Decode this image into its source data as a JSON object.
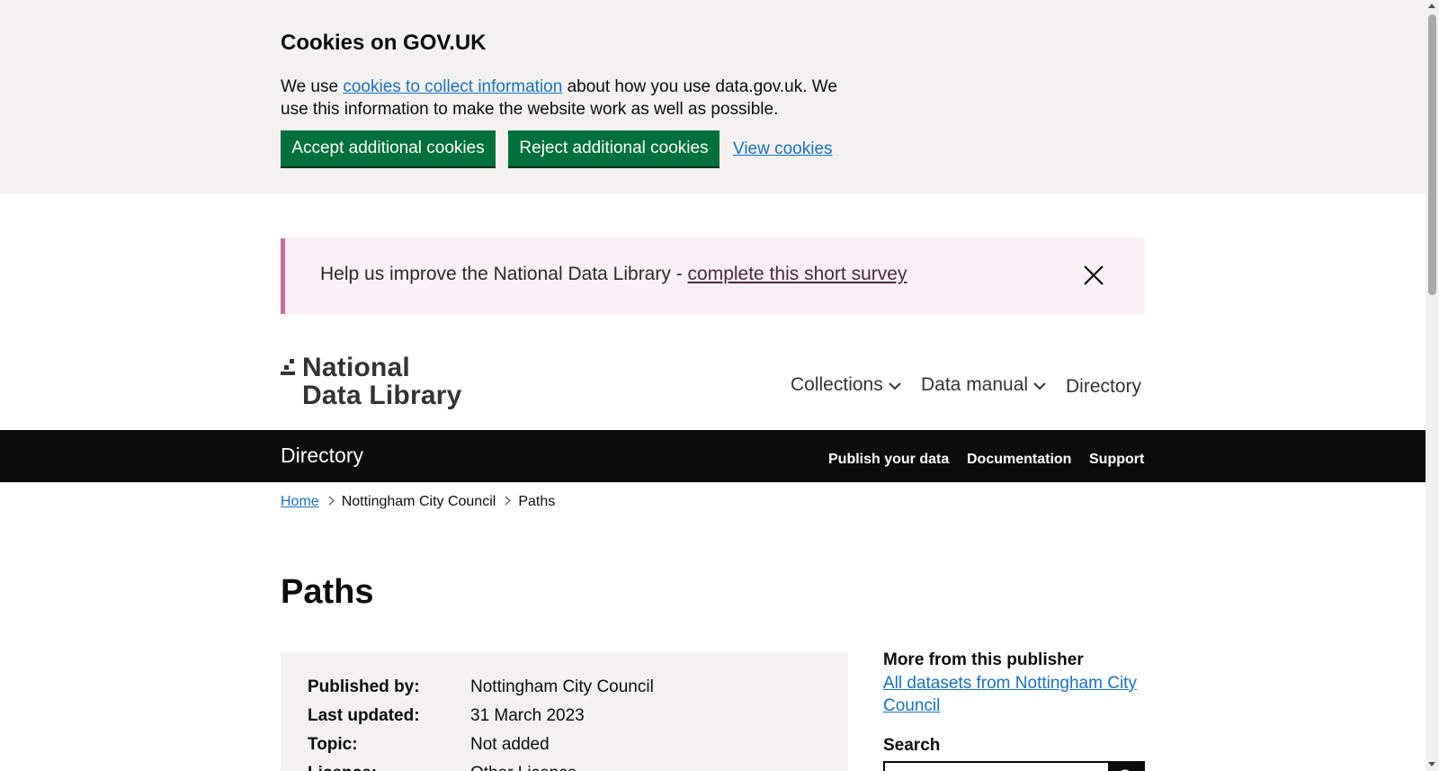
{
  "cookie_banner": {
    "title": "Cookies on GOV.UK",
    "text_before": "We use ",
    "link": "cookies to collect information",
    "text_after": " about how you use data.gov.uk. We use this information to make the website work as well as possible.",
    "accept_label": "Accept additional cookies",
    "reject_label": "Reject additional cookies",
    "view_label": "View cookies"
  },
  "survey": {
    "text": "Help us improve the National Data Library - ",
    "link": "complete this short survey",
    "close_icon": "close-icon"
  },
  "header": {
    "logo_line1": "National",
    "logo_line2": "Data Library",
    "nav": {
      "collections": "Collections",
      "data_manual": "Data manual",
      "directory": "Directory"
    }
  },
  "service_bar": {
    "name": "Directory",
    "publish": "Publish your data",
    "documentation": "Documentation",
    "support": "Support"
  },
  "breadcrumb": {
    "home": "Home",
    "publisher": "Nottingham City Council",
    "current": "Paths"
  },
  "page_title": "Paths",
  "summary": [
    {
      "key": "Published by:",
      "value": "Nottingham City Council"
    },
    {
      "key": "Last updated:",
      "value": "31 March 2023"
    },
    {
      "key": "Topic:",
      "value": "Not added"
    },
    {
      "key": "Licence:",
      "value": "Other Licence"
    }
  ],
  "sidebar": {
    "more_heading": "More from this publisher",
    "all_datasets_link": "All datasets from Nottingham City Council",
    "search_heading": "Search",
    "search_icon": "search-icon"
  },
  "colors": {
    "green_button": "#00703c",
    "link_blue": "#1d70b8",
    "survey_border": "#c96d9a",
    "black_bar": "#0b0c0c",
    "grey_bg": "#f3f2f1"
  }
}
